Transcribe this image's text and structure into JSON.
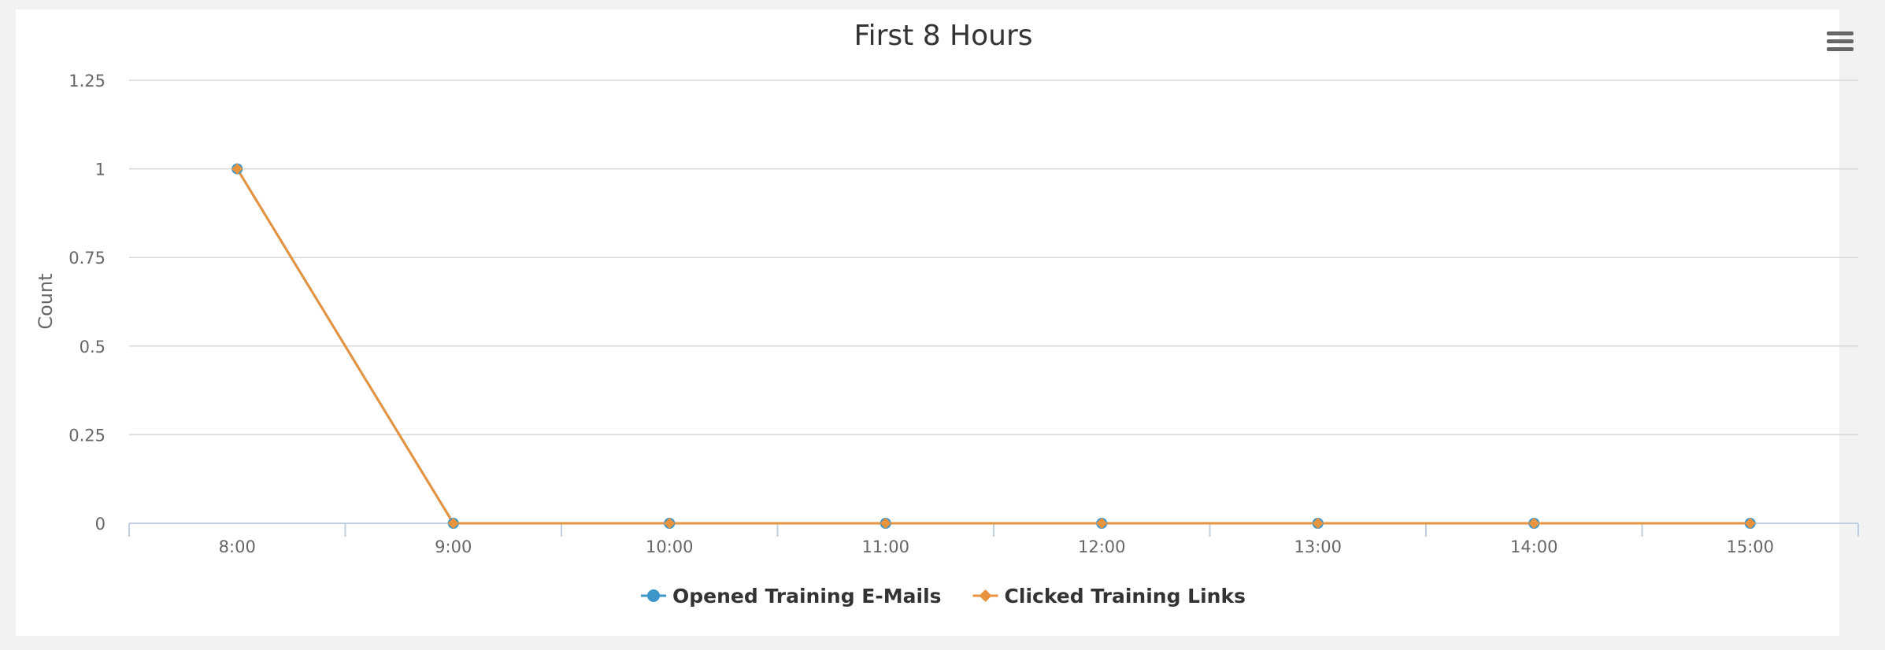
{
  "chart_data": {
    "type": "line",
    "title": "First 8 Hours",
    "xlabel": "",
    "ylabel": "Count",
    "categories": [
      "8:00",
      "9:00",
      "10:00",
      "11:00",
      "12:00",
      "13:00",
      "14:00",
      "15:00"
    ],
    "yticks": [
      "0",
      "0.25",
      "0.5",
      "0.75",
      "1",
      "1.25"
    ],
    "ylim": [
      0,
      1.25
    ],
    "grid": true,
    "legend_position": "bottom-center",
    "series": [
      {
        "name": "Opened Training E-Mails",
        "values": [
          1,
          0,
          0,
          0,
          0,
          0,
          0,
          0
        ],
        "color": "#3d96ca",
        "marker": "circle"
      },
      {
        "name": "Clicked Training Links",
        "values": [
          1,
          0,
          0,
          0,
          0,
          0,
          0,
          0
        ],
        "color": "#e8933d",
        "marker": "diamond"
      }
    ]
  },
  "icons": {
    "menu": "hamburger-menu-icon"
  }
}
